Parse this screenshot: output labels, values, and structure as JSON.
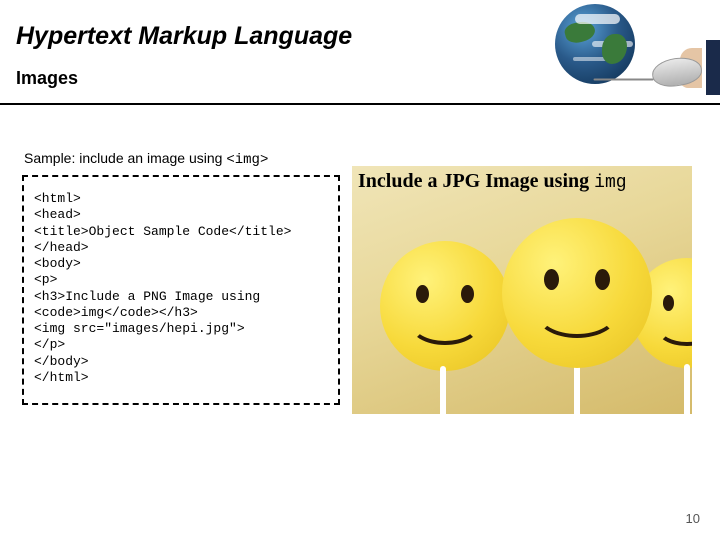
{
  "header": {
    "title": "Hypertext Markup Language",
    "subtitle": "Images"
  },
  "sample": {
    "label_prefix": "Sample: include an image using ",
    "label_tag": "<img>"
  },
  "code": "<html>\n<head>\n<title>Object Sample Code</title>\n</head>\n<body>\n<p>\n<h3>Include a PNG Image using\n<code>img</code></h3>\n<img src=\"images/hepi.jpg\">\n</p>\n</body>\n</html>",
  "preview": {
    "heading_prefix": "Include a JPG Image using ",
    "heading_code": "img"
  },
  "page_number": "10"
}
